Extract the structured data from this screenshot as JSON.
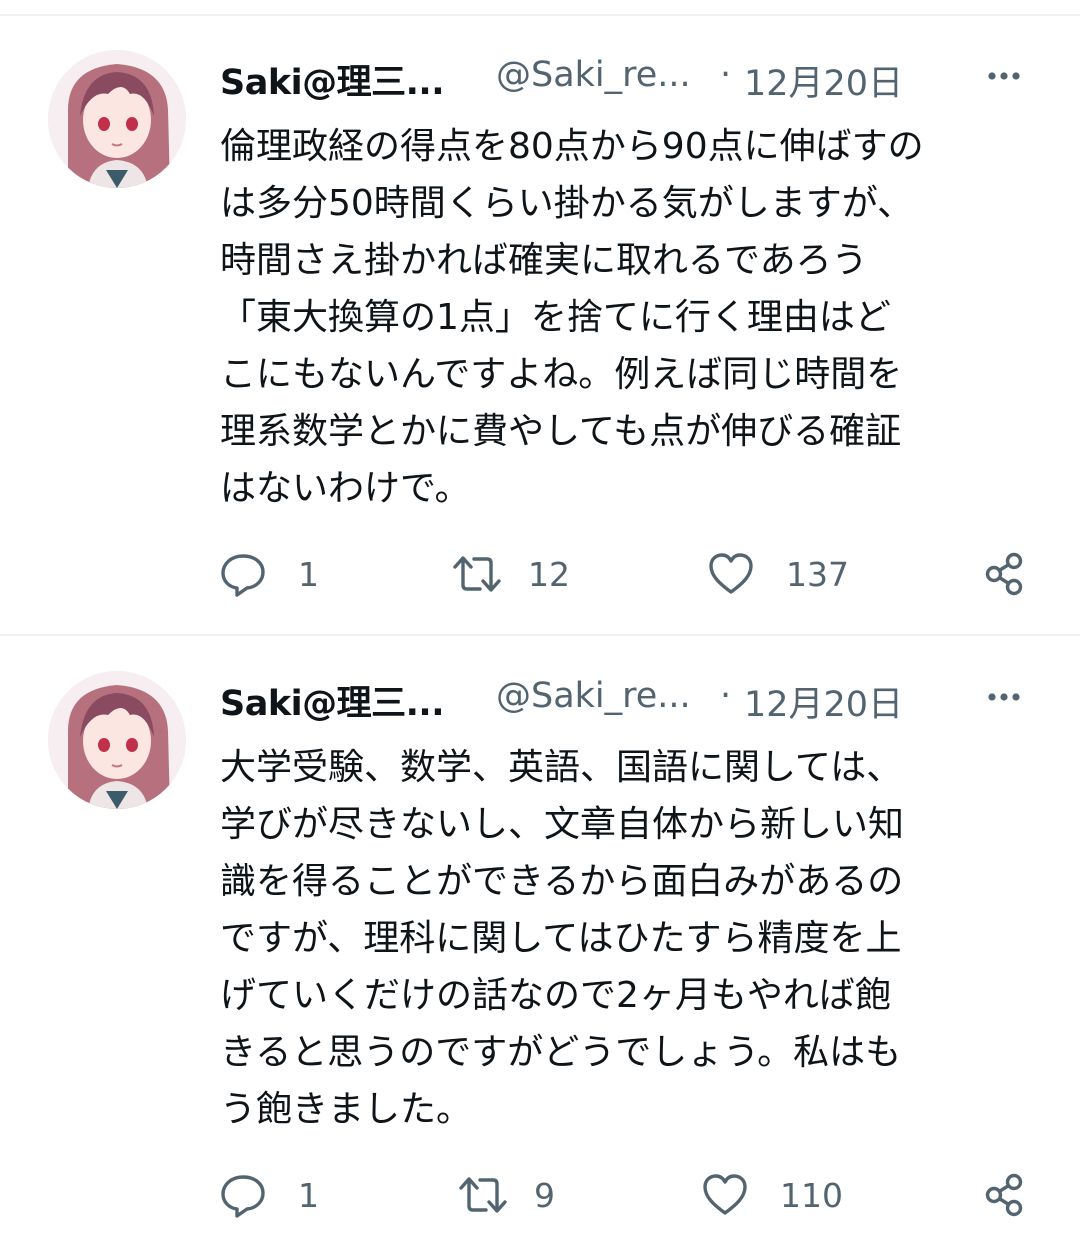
{
  "tweets": [
    {
      "name": "Saki@理三...",
      "handle": "@Saki_re...",
      "dot": "·",
      "date": "12月20日",
      "lines": [
        "倫理政経の得点を80点から90点に伸ばすの",
        "は多分50時間くらい掛かる気がしますが、",
        "時間さえ掛かれば確実に取れるであろう",
        "「東大換算の1点」を捨てに行く理由はど",
        "こにもないんですよね。例えば同じ時間を",
        "理系数学とかに費やしても点が伸びる確証",
        "はないわけで。"
      ],
      "replies": "1",
      "retweets": "12",
      "likes": "137"
    },
    {
      "name": "Saki@理三...",
      "handle": "@Saki_re...",
      "dot": "·",
      "date": "12月20日",
      "lines": [
        "大学受験、数学、英語、国語に関しては、",
        "学びが尽きないし、文章自体から新しい知",
        "識を得ることができるから面白みがあるの",
        "ですが、理科に関してはひたすら精度を上",
        "げていくだけの話なので2ヶ月もやれば飽",
        "きると思うのですがどうでしょう。私はも",
        "う飽きました。"
      ],
      "replies": "1",
      "retweets": "9",
      "likes": "110"
    }
  ],
  "icons": {
    "reply": "reply-icon",
    "retweet": "retweet-icon",
    "like": "heart-icon",
    "share": "share-icon",
    "more": "more-icon"
  },
  "colors": {
    "text": "#0f1419",
    "secondary": "#536471",
    "divider": "#eff3f4"
  }
}
